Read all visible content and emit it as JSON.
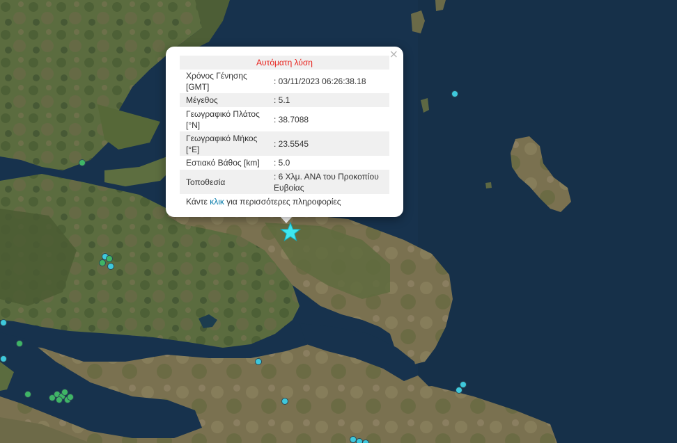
{
  "popup": {
    "header": "Αυτόματη λύση",
    "close_symbol": "×",
    "rows": [
      {
        "label": "Χρόνος Γένησης [GMT]",
        "value": ": 03/11/2023 06:26:38.18"
      },
      {
        "label": "Μέγεθος",
        "value": ": 5.1"
      },
      {
        "label": "Γεωγραφικό Πλάτος [°N]",
        "value": ": 38.7088"
      },
      {
        "label": "Γεωγραφικό Μήκος [°E]",
        "value": ": 23.5545"
      },
      {
        "label": "Εστιακό Βάθος [km]",
        "value": ": 5.0"
      },
      {
        "label": "Τοποθεσία",
        "value": ": 6 Χλμ. ΑΝΑ του Προκοπίου Ευβοίας"
      }
    ],
    "more_prefix": "Κάντε ",
    "more_link": "κλικ",
    "more_suffix": " για περισσότερες πληροφορίες"
  },
  "map": {
    "sea_color": "#17324d",
    "land_color": "#5a6b3e",
    "marker_colors": {
      "recent": "#3ec8dc",
      "older": "#3fb566"
    },
    "epicenter_icon": "star-icon",
    "epicenter_color": "#3de6f0"
  }
}
